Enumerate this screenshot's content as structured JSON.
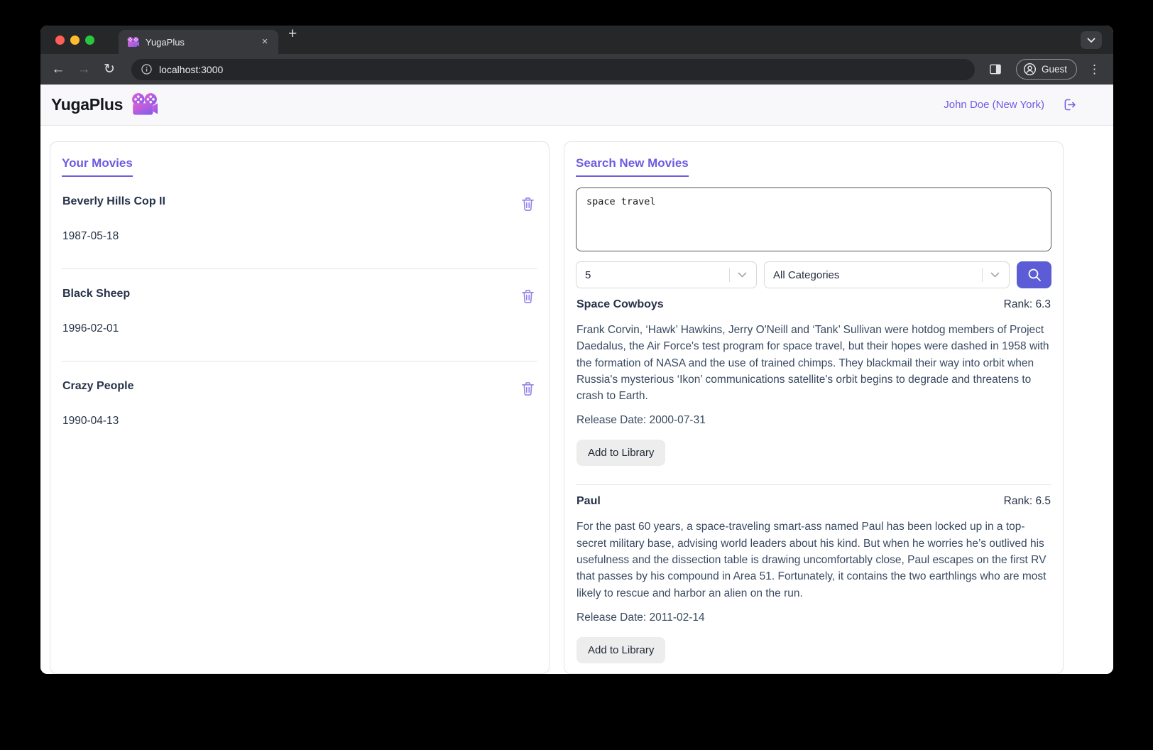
{
  "colors": {
    "accent": "#6d5be2",
    "search_button": "#5c5cd6",
    "trash_icon": "#9383ea",
    "chrome_bg": "#262729",
    "toolbar_bg": "#38393c"
  },
  "browser": {
    "tab_title": "YugaPlus",
    "url": "localhost:3000",
    "guest_label": "Guest",
    "icons": {
      "back": "←",
      "forward": "→",
      "reload": "↻",
      "menu": "⋮",
      "new_tab": "+",
      "close_tab": "×"
    }
  },
  "header": {
    "brand": "YugaPlus",
    "user": "John Doe (New York)"
  },
  "your_movies": {
    "title": "Your Movies",
    "movies": [
      {
        "title": "Beverly Hills Cop II",
        "date": "1987-05-18"
      },
      {
        "title": "Black Sheep",
        "date": "1996-02-01"
      },
      {
        "title": "Crazy People",
        "date": "1990-04-13"
      }
    ]
  },
  "search": {
    "title": "Search New Movies",
    "query": "space travel",
    "limit_value": "5",
    "category_value": "All Categories",
    "results": [
      {
        "title": "Space Cowboys",
        "rank_label": "Rank: 6.3",
        "description": "Frank Corvin, ‘Hawk’ Hawkins, Jerry O'Neill and ‘Tank’ Sullivan were hotdog members of Project Daedalus, the Air Force's test program for space travel, but their hopes were dashed in 1958 with the formation of NASA and the use of trained chimps. They blackmail their way into orbit when Russia's mysterious ‘Ikon’ communications satellite's orbit begins to degrade and threatens to crash to Earth.",
        "release_label": "Release Date: 2000-07-31",
        "add_label": "Add to Library"
      },
      {
        "title": "Paul",
        "rank_label": "Rank: 6.5",
        "description": "For the past 60 years, a space-traveling smart-ass named Paul has been locked up in a top-secret military base, advising world leaders about his kind. But when he worries he’s outlived his usefulness and the dissection table is drawing uncomfortably close, Paul escapes on the first RV that passes by his compound in Area 51. Fortunately, it contains the two earthlings who are most likely to rescue and harbor an alien on the run.",
        "release_label": "Release Date: 2011-02-14",
        "add_label": "Add to Library"
      }
    ]
  }
}
